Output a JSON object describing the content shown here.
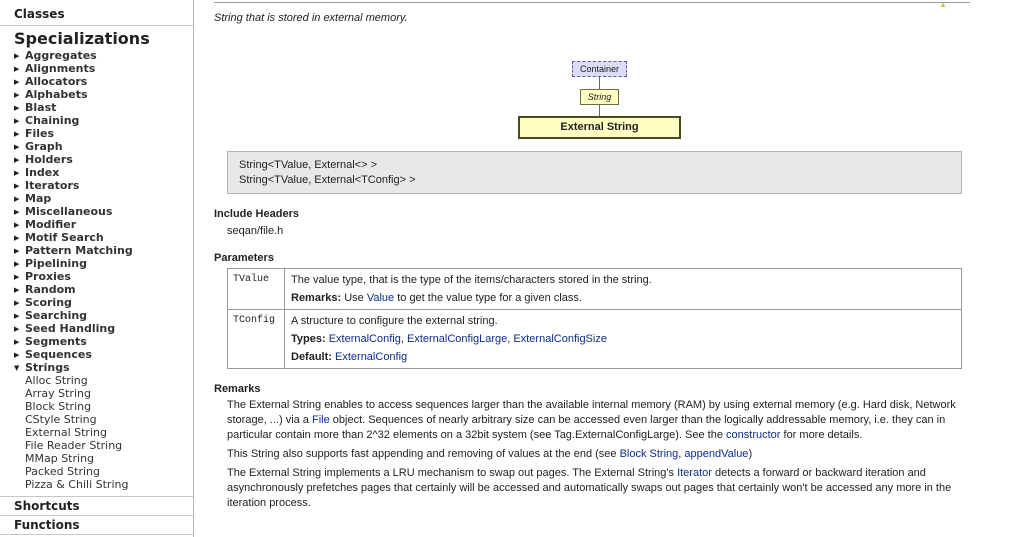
{
  "sidebar": {
    "classes_label": "Classes",
    "title": "Specializations",
    "categories": [
      "Aggregates",
      "Alignments",
      "Allocators",
      "Alphabets",
      "Blast",
      "Chaining",
      "Files",
      "Graph",
      "Holders",
      "Index",
      "Iterators",
      "Map",
      "Miscellaneous",
      "Modifier",
      "Motif Search",
      "Pattern Matching",
      "Pipelining",
      "Proxies",
      "Random",
      "Scoring",
      "Searching",
      "Seed Handling",
      "Segments",
      "Sequences"
    ],
    "expanded_category": "Strings",
    "string_items": [
      "Alloc String",
      "Array String",
      "Block String",
      "CStyle String",
      "External String",
      "File Reader String",
      "MMap String",
      "Packed String",
      "Pizza & Chili String"
    ],
    "shortcuts_label": "Shortcuts",
    "functions_label": "Functions"
  },
  "main": {
    "intro": "String that is stored in external memory.",
    "diagram": {
      "container": "Container",
      "string": "String",
      "external": "External String"
    },
    "signatures": [
      "String<TValue, External<> >",
      "String<TValue, External<TConfig> >"
    ],
    "include_headers": {
      "heading": "Include Headers",
      "value": "seqan/file.h"
    },
    "parameters": {
      "heading": "Parameters",
      "rows": [
        {
          "name": "TValue",
          "desc": "The value type, that is the type of the items/characters stored in the string.",
          "remarks_label": "Remarks:",
          "remarks_pre": " Use ",
          "remarks_link": "Value",
          "remarks_post": " to get the value type for a given class."
        },
        {
          "name": "TConfig",
          "desc": "A structure to configure the external string.",
          "types_label": "Types:",
          "types_links": [
            "ExternalConfig",
            "ExternalConfigLarge",
            "ExternalConfigSize"
          ],
          "default_label": "Default:",
          "default_link": "ExternalConfig"
        }
      ]
    },
    "remarks": {
      "heading": "Remarks",
      "p1_a": "The External String enables to access sequences larger than the available internal memory (RAM) by using external memory (e.g. Hard disk, Network storage, ...) via a ",
      "p1_link1": "File",
      "p1_b": " object. Sequences of nearly arbitrary size can be accessed even larger than the logically addressable memory, i.e. they can in particular contain more than 2^32 elements on a 32bit system (see Tag.ExternalConfigLarge). See the ",
      "p1_link2": "constructor",
      "p1_c": " for more details.",
      "p2_a": "This String also supports fast appending and removing of values at the end (see ",
      "p2_link1": "Block String",
      "p2_sep": ", ",
      "p2_link2": "appendValue",
      "p2_b": ")",
      "p3_a": "The External String implements a LRU mechanism to swap out pages. The External String's ",
      "p3_link": "Iterator",
      "p3_b": " detects a forward or backward iteration and asynchronously prefetches pages that certainly will be accessed and automatically swaps out pages that certainly won't be accessed any more in the iteration process."
    }
  }
}
